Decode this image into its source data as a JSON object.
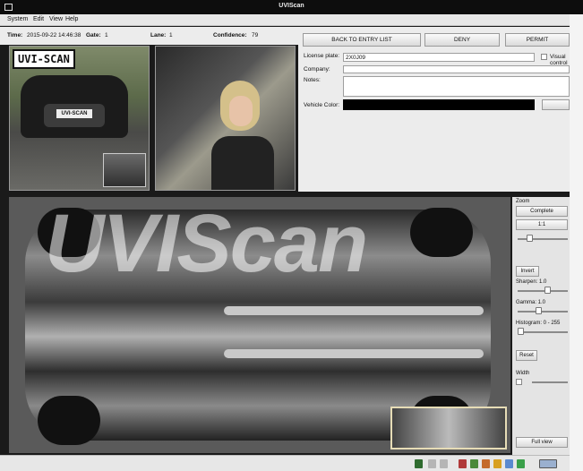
{
  "window": {
    "title": "UVIScan"
  },
  "menu": {
    "items": [
      "System",
      "Edit",
      "View",
      "Help"
    ]
  },
  "info": {
    "time_label": "Time:",
    "time_value": "2015-09-22 14:46:38",
    "gate_label": "Gate:",
    "gate_value": "1",
    "lane_label": "Lane:",
    "lane_value": "1",
    "confidence_label": "Confidence:",
    "confidence_value": "79"
  },
  "photos": {
    "plate_banner": "UVI-SCAN",
    "car_plate": "UVI-SCAN"
  },
  "actions": {
    "back_label": "BACK TO ENTRY LIST",
    "deny_label": "DENY",
    "permit_label": "PERMIT"
  },
  "form": {
    "license_label": "License plate:",
    "license_value": "2X0J09",
    "visual_control_label": "Visual control",
    "company_label": "Company:",
    "company_value": "",
    "notes_label": "Notes:",
    "notes_value": "",
    "color_label": "Vehicle Color:",
    "vehicle_color": "#000000"
  },
  "scan": {
    "watermark": "UVIScan"
  },
  "zoom": {
    "title": "Zoom",
    "complete_label": "Complete",
    "ratio_label": "1:1",
    "invert_label": "Invert",
    "sharpen_label": "Sharpen: 1.0",
    "gamma_label": "Gamma: 1.0",
    "histogram_label": "Histogram: 0 - 255",
    "reset_label": "Reset",
    "width_label": "Width",
    "fullview_label": "Full view"
  },
  "colors": {
    "accent": "#e6dcb6",
    "title_bg": "#0d0d0d",
    "panel_bg": "#ececec"
  }
}
